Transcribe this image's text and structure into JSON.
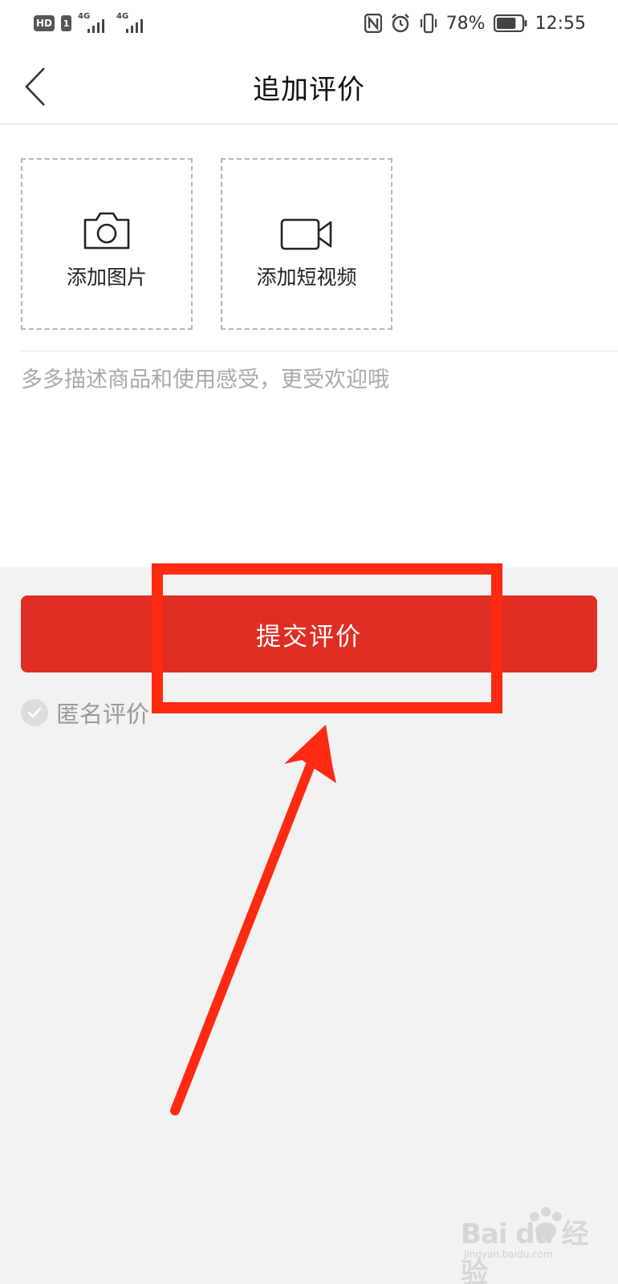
{
  "status_bar": {
    "hd_label": "HD",
    "sim_label": "1",
    "network_1": "4G",
    "network_2": "4G",
    "battery_percent": "78%",
    "time": "12:55",
    "battery_level": 0.78
  },
  "header": {
    "title": "追加评价"
  },
  "upload": {
    "photo_label": "添加图片",
    "video_label": "添加短视频"
  },
  "review": {
    "placeholder": "多多描述商品和使用感受，更受欢迎哦",
    "value": ""
  },
  "submit": {
    "label": "提交评价"
  },
  "anonymous": {
    "label": "匿名评价",
    "checked": false
  },
  "annotation": {
    "color": "#ff2a12"
  },
  "watermark": {
    "brand": "Bai du 经验",
    "site": "jingyan.baidu.com"
  },
  "colors": {
    "accent": "#e02e24",
    "background": "#f2f2f2",
    "panel": "#ffffff"
  }
}
